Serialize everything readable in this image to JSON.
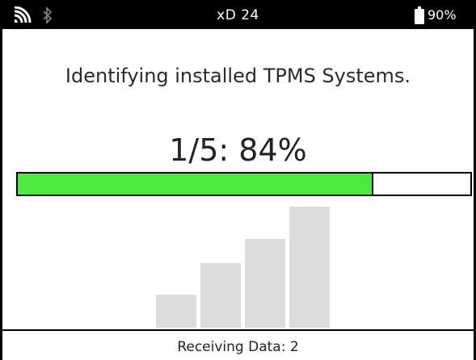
{
  "status_bar": {
    "title": "xD 24",
    "battery": "90%",
    "icons": [
      "wifi-icon",
      "bluetooth-icon",
      "battery-icon"
    ]
  },
  "message": "Identifying installed TPMS Systems.",
  "progress": {
    "label": "1/5: 84%",
    "fraction": 0.786,
    "fill_color": "#4cea3c"
  },
  "signal_strength": {
    "levels": [
      0.27,
      0.53,
      0.73,
      1.0
    ],
    "color": "#dcdcdc"
  },
  "footer": {
    "status": "Receiving Data: 2"
  }
}
